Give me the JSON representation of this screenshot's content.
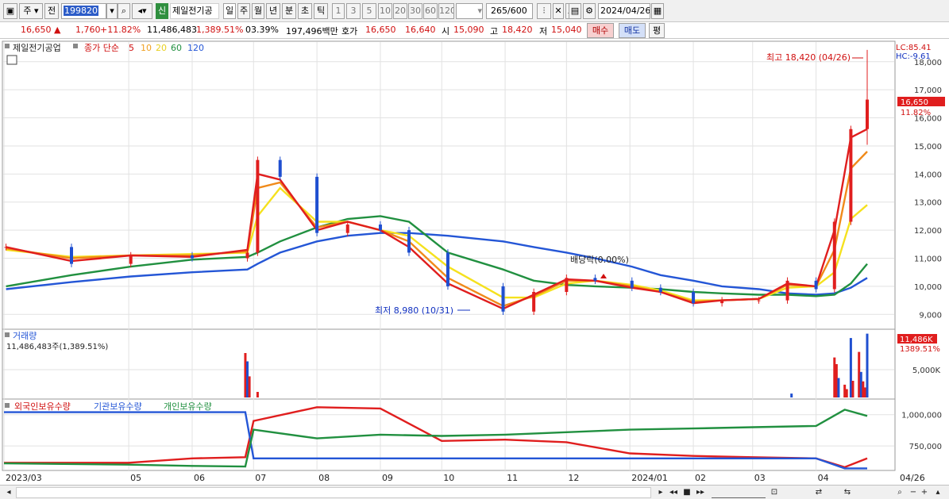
{
  "toolbar": {
    "type_label": "주",
    "side_label": "전",
    "stock_code": "199820",
    "new_badge": "신",
    "stock_name": "제일전기공",
    "periods": [
      "일",
      "주",
      "월",
      "년",
      "분",
      "초",
      "틱"
    ],
    "active_period": "일",
    "intervals": [
      "1",
      "3",
      "5",
      "10",
      "20",
      "30",
      "60",
      "120"
    ],
    "count_value": "265",
    "count_total": "/600",
    "date_value": "2024/04/26"
  },
  "quote": {
    "price": "16,650",
    "change_arrow": "▲",
    "change": "1,760",
    "change_pct": "+11.82%",
    "volume": "11,486,483",
    "volume_pct": "1,389.51%",
    "turnover_pct": "03.39%",
    "amount": "197,496백만",
    "ask_label": "호가",
    "ask": "16,650",
    "bid": "16,640",
    "open_label": "시",
    "open": "15,090",
    "high_label": "고",
    "high": "18,420",
    "low_label": "저",
    "low": "15,040",
    "buy_button": "매수",
    "sell_button": "매도",
    "eval_button": "평"
  },
  "price_panel": {
    "stock_title": "제일전기공업",
    "ma_prefix": "종가 단순",
    "ma_periods": [
      "5",
      "10",
      "20",
      "60",
      "120"
    ],
    "lc_label": "LC:85.41",
    "hc_label": "HC:-9.61",
    "current_price_label": "16,650",
    "current_pct_label": "11.82%",
    "high_annotation": "최고 18,420 (04/26)",
    "low_annotation": "최저 8,980 (10/31)",
    "dividend_annotation": "배당락(0.00%)"
  },
  "volume_panel": {
    "title": "거래량",
    "info": "11,486,483주(1,389.51%)",
    "current_label": "11,486K",
    "current_pct": "1389.51%"
  },
  "holding_panel": {
    "foreign_label": "외국인보유수량",
    "inst_label": "기관보유수량",
    "retail_label": "개인보유수량"
  },
  "x_axis": {
    "labels": [
      "2023/03",
      "05",
      "06",
      "07",
      "08",
      "09",
      "10",
      "11",
      "12",
      "2024/01",
      "02",
      "03",
      "04"
    ],
    "last_label": "04/26"
  },
  "colors": {
    "up": "#e01e1e",
    "down": "#1f4fd0",
    "ma5": "#e01e1e",
    "ma10": "#f08a1a",
    "ma20": "#f5e11e",
    "ma60": "#219040",
    "ma120": "#2456d6",
    "grid": "#e2e2e2"
  },
  "chart_data": [
    {
      "type": "candlestick",
      "title": "제일전기공업",
      "y_axis_ticks": [
        9000,
        10000,
        11000,
        12000,
        13000,
        14000,
        15000,
        16000,
        17000,
        18000
      ],
      "ylim": [
        8500,
        18700
      ],
      "x_range": [
        "2023/03",
        "2024/04/26"
      ],
      "grid": true,
      "series": [
        {
          "name": "종가",
          "x": [
            "2023/03/02",
            "2023/04/03",
            "2023/05/02",
            "2023/06/01",
            "2023/06/28",
            "2023/07/03",
            "2023/07/14",
            "2023/08/01",
            "2023/08/16",
            "2023/09/01",
            "2023/09/15",
            "2023/10/04",
            "2023/10/31",
            "2023/11/15",
            "2023/12/01",
            "2023/12/15",
            "2024/01/02",
            "2024/01/16",
            "2024/02/01",
            "2024/02/15",
            "2024/03/04",
            "2024/03/18",
            "2024/04/01",
            "2024/04/10",
            "2024/04/18",
            "2024/04/26"
          ],
          "y": [
            11400,
            10800,
            11100,
            11000,
            11200,
            14500,
            13900,
            11900,
            12200,
            12000,
            11200,
            10000,
            9100,
            9800,
            10300,
            10200,
            9950,
            9800,
            9400,
            9500,
            9500,
            10200,
            9900,
            12300,
            15600,
            16650
          ]
        },
        {
          "name": "5",
          "y": [
            11400,
            10900,
            11100,
            11050,
            11300,
            14000,
            13800,
            12000,
            12300,
            12000,
            11400,
            10100,
            9200,
            9700,
            10250,
            10200,
            9950,
            9800,
            9400,
            9500,
            9550,
            10100,
            10000,
            12000,
            15300,
            15600
          ]
        },
        {
          "name": "10",
          "y": [
            11350,
            11000,
            11100,
            11100,
            11250,
            13500,
            13700,
            12100,
            12300,
            12000,
            11600,
            10300,
            9300,
            9650,
            10200,
            10200,
            10000,
            9800,
            9450,
            9500,
            9550,
            10050,
            10000,
            11300,
            14200,
            14800
          ]
        },
        {
          "name": "20",
          "y": [
            11300,
            11050,
            11100,
            11150,
            11200,
            12500,
            13500,
            12300,
            12300,
            12000,
            11800,
            10700,
            9600,
            9600,
            10100,
            10200,
            10050,
            9850,
            9500,
            9500,
            9550,
            9950,
            10000,
            10500,
            12400,
            12900
          ]
        },
        {
          "name": "60",
          "y": [
            10000,
            10400,
            10700,
            10950,
            11050,
            11200,
            11600,
            12100,
            12400,
            12500,
            12300,
            11200,
            10600,
            10200,
            10050,
            10000,
            9950,
            9900,
            9800,
            9750,
            9700,
            9700,
            9650,
            9700,
            10100,
            10800
          ]
        },
        {
          "name": "120",
          "y": [
            9900,
            10150,
            10350,
            10500,
            10600,
            10800,
            11200,
            11600,
            11800,
            11900,
            11900,
            11800,
            11600,
            11400,
            11200,
            11000,
            10700,
            10400,
            10200,
            10000,
            9900,
            9750,
            9700,
            9750,
            9950,
            10300
          ]
        }
      ],
      "annotations": [
        "최고 18,420 (04/26)",
        "최저 8,980 (10/31)",
        "배당락(0.00%)"
      ]
    },
    {
      "type": "bar",
      "title": "거래량",
      "y_axis_ticks": [
        5000
      ],
      "y_unit": "K",
      "ylim": [
        0,
        12000
      ],
      "series": [
        {
          "name": "거래량",
          "x": [
            "2023/06/27",
            "2023/06/28",
            "2023/06/29",
            "2023/07/03",
            "2024/03/20",
            "2024/04/10",
            "2024/04/11",
            "2024/04/12",
            "2024/04/15",
            "2024/04/16",
            "2024/04/18",
            "2024/04/19",
            "2024/04/22",
            "2024/04/23",
            "2024/04/24",
            "2024/04/25",
            "2024/04/26"
          ],
          "y": [
            8000,
            6500,
            3800,
            1000,
            700,
            7200,
            6000,
            3500,
            2300,
            1500,
            10700,
            3000,
            8200,
            4600,
            2900,
            1800,
            11486
          ]
        }
      ]
    },
    {
      "type": "line",
      "title": "보유수량",
      "y_axis_ticks": [
        750000,
        1000000
      ],
      "series": [
        {
          "name": "외국인보유수량",
          "x": [
            "2023/03",
            "2023/05",
            "2023/06",
            "2023/06/27",
            "2023/07",
            "2023/08",
            "2023/09",
            "2023/10",
            "2023/11",
            "2023/12",
            "2024/01",
            "2024/02",
            "2024/03",
            "2024/04/01",
            "2024/04/15",
            "2024/04/26"
          ],
          "y": [
            615000,
            615000,
            650000,
            660000,
            950000,
            1060000,
            1050000,
            790000,
            800000,
            780000,
            690000,
            670000,
            660000,
            650000,
            580000,
            650000
          ]
        },
        {
          "name": "기관보유수량",
          "x": [
            "2023/03",
            "2023/05",
            "2023/06",
            "2023/06/27",
            "2023/07",
            "2023/08",
            "2023/09",
            "2023/10",
            "2023/11",
            "2023/12",
            "2024/01",
            "2024/02",
            "2024/03",
            "2024/04/01",
            "2024/04/15",
            "2024/04/26"
          ],
          "y": [
            1020000,
            1020000,
            1020000,
            1020000,
            650000,
            650000,
            650000,
            650000,
            650000,
            650000,
            650000,
            650000,
            650000,
            650000,
            570000,
            570000
          ]
        },
        {
          "name": "개인보유수량",
          "x": [
            "2023/03",
            "2023/05",
            "2023/06",
            "2023/06/27",
            "2023/07",
            "2023/08",
            "2023/09",
            "2023/10",
            "2023/11",
            "2023/12",
            "2024/01",
            "2024/02",
            "2024/03",
            "2024/04/01",
            "2024/04/15",
            "2024/04/26"
          ],
          "y": [
            610000,
            600000,
            590000,
            585000,
            880000,
            810000,
            840000,
            830000,
            840000,
            860000,
            880000,
            890000,
            900000,
            910000,
            1040000,
            990000
          ]
        }
      ]
    }
  ]
}
